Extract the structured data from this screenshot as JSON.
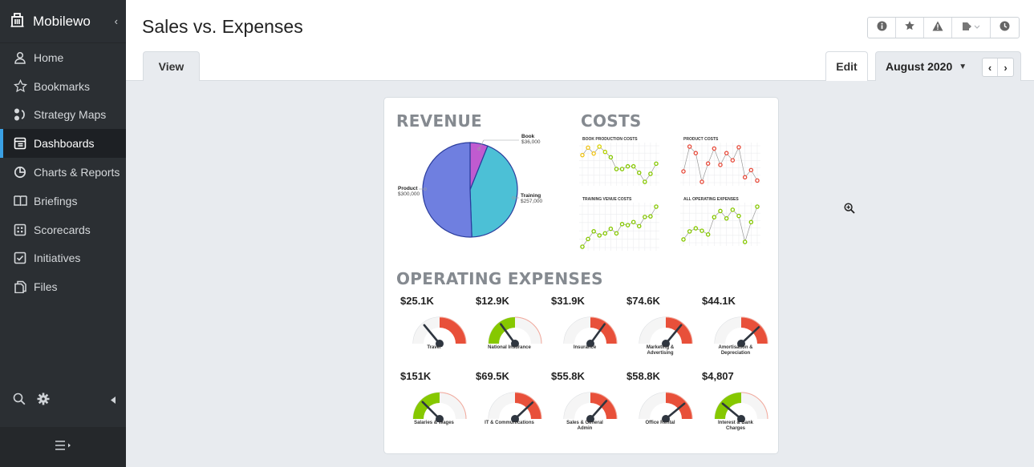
{
  "app": {
    "name": "Mobilewo"
  },
  "sidebar": {
    "items": [
      {
        "label": "Home",
        "icon": "user-icon",
        "active": false
      },
      {
        "label": "Bookmarks",
        "icon": "star-icon",
        "active": false
      },
      {
        "label": "Strategy Maps",
        "icon": "strategy-map-icon",
        "active": false
      },
      {
        "label": "Dashboards",
        "icon": "dashboard-icon",
        "active": true
      },
      {
        "label": "Charts & Reports",
        "icon": "pie-chart-icon",
        "active": false
      },
      {
        "label": "Briefings",
        "icon": "book-icon",
        "active": false
      },
      {
        "label": "Scorecards",
        "icon": "scorecard-icon",
        "active": false
      },
      {
        "label": "Initiatives",
        "icon": "checkbox-icon",
        "active": false
      },
      {
        "label": "Files",
        "icon": "files-icon",
        "active": false
      }
    ]
  },
  "header": {
    "title": "Sales vs. Expenses",
    "tab_view": "View",
    "edit_label": "Edit",
    "period": "August 2020"
  },
  "dashboard": {
    "revenue": {
      "title": "REVENUE",
      "slices": [
        {
          "name": "Book",
          "value_label": "$36,000",
          "value": 36000,
          "color": "#c05bd0"
        },
        {
          "name": "Training",
          "value_label": "$257,000",
          "value": 257000,
          "color": "#4cc0d6"
        },
        {
          "name": "Product",
          "value_label": "$300,000",
          "value": 300000,
          "color": "#6f7fe0"
        }
      ]
    },
    "costs": {
      "title": "COSTS",
      "charts": [
        {
          "title": "BOOK PRODUCTION COSTS",
          "colors": [
            "#f0c419",
            "#f0c419",
            "#f0c419",
            "#d9d200",
            "#b6d200",
            "#86c800",
            "#86c800",
            "#86c800",
            "#86c800",
            "#86c800",
            "#86c800",
            "#86c800",
            "#86c800"
          ],
          "values": [
            5.2,
            6.6,
            5.5,
            6.8,
            5.8,
            4.8,
            2.6,
            2.6,
            3.1,
            3.1,
            1.9,
            0.2,
            1.7,
            3.6
          ]
        },
        {
          "title": "PRODUCT COSTS",
          "colors": [
            "#e74c3c"
          ],
          "values": [
            3,
            6.8,
            5.8,
            1.4,
            4.2,
            6.5,
            4,
            5.8,
            4.7,
            6.7,
            2.1,
            3.2,
            1.6
          ]
        },
        {
          "title": "TRAINING VENUE COSTS",
          "colors": [
            "#86c800"
          ],
          "values": [
            1,
            2.5,
            4,
            3.2,
            3.6,
            4.5,
            3.6,
            5.4,
            5.2,
            5.8,
            5,
            6.8,
            6.9,
            8.8
          ]
        },
        {
          "title": "ALL OPERATING EXPENSES",
          "colors": [
            "#86c800"
          ],
          "values": [
            2.2,
            3.5,
            4,
            3.6,
            3,
            5.8,
            6.8,
            5.6,
            7,
            6,
            1.8,
            5,
            7.5
          ]
        }
      ]
    },
    "operating_expenses": {
      "title": "OPERATING EXPENSES",
      "gauges": [
        {
          "value": "$25.1K",
          "label": "Travel",
          "ratio": 0.28,
          "scheme": "red"
        },
        {
          "value": "$12.9K",
          "label": "National Insurance",
          "ratio": 0.3,
          "scheme": "green"
        },
        {
          "value": "$31.9K",
          "label": "Insurance",
          "ratio": 0.7,
          "scheme": "red"
        },
        {
          "value": "$74.6K",
          "label": "Marketing & Advertising",
          "ratio": 0.72,
          "scheme": "red"
        },
        {
          "value": "$44.1K",
          "label": "Amortisation & Depreciation",
          "ratio": 0.76,
          "scheme": "red"
        },
        {
          "value": "$151K",
          "label": "Salaries & Wages",
          "ratio": 0.25,
          "scheme": "green"
        },
        {
          "value": "$69.5K",
          "label": "IT & Communications",
          "ratio": 0.76,
          "scheme": "red"
        },
        {
          "value": "$55.8K",
          "label": "Sales & General Admin",
          "ratio": 0.73,
          "scheme": "red"
        },
        {
          "value": "$58.8K",
          "label": "Office Rental",
          "ratio": 0.78,
          "scheme": "red"
        },
        {
          "value": "$4,807",
          "label": "Interest & Bank Charges",
          "ratio": 0.22,
          "scheme": "green"
        }
      ]
    }
  },
  "colors": {
    "accent": "#3aa0e4",
    "sidebar_bg": "#2b2f33",
    "gauge_red": "#e8503a",
    "gauge_green": "#86c800"
  }
}
